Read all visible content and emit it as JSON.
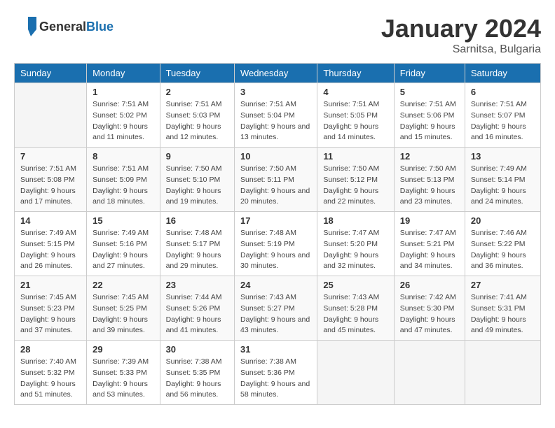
{
  "logo": {
    "general": "General",
    "blue": "Blue"
  },
  "title": "January 2024",
  "subtitle": "Sarnitsa, Bulgaria",
  "days_of_week": [
    "Sunday",
    "Monday",
    "Tuesday",
    "Wednesday",
    "Thursday",
    "Friday",
    "Saturday"
  ],
  "weeks": [
    [
      {
        "num": "",
        "sunrise": "",
        "sunset": "",
        "daylight": ""
      },
      {
        "num": "1",
        "sunrise": "Sunrise: 7:51 AM",
        "sunset": "Sunset: 5:02 PM",
        "daylight": "Daylight: 9 hours and 11 minutes."
      },
      {
        "num": "2",
        "sunrise": "Sunrise: 7:51 AM",
        "sunset": "Sunset: 5:03 PM",
        "daylight": "Daylight: 9 hours and 12 minutes."
      },
      {
        "num": "3",
        "sunrise": "Sunrise: 7:51 AM",
        "sunset": "Sunset: 5:04 PM",
        "daylight": "Daylight: 9 hours and 13 minutes."
      },
      {
        "num": "4",
        "sunrise": "Sunrise: 7:51 AM",
        "sunset": "Sunset: 5:05 PM",
        "daylight": "Daylight: 9 hours and 14 minutes."
      },
      {
        "num": "5",
        "sunrise": "Sunrise: 7:51 AM",
        "sunset": "Sunset: 5:06 PM",
        "daylight": "Daylight: 9 hours and 15 minutes."
      },
      {
        "num": "6",
        "sunrise": "Sunrise: 7:51 AM",
        "sunset": "Sunset: 5:07 PM",
        "daylight": "Daylight: 9 hours and 16 minutes."
      }
    ],
    [
      {
        "num": "7",
        "sunrise": "Sunrise: 7:51 AM",
        "sunset": "Sunset: 5:08 PM",
        "daylight": "Daylight: 9 hours and 17 minutes."
      },
      {
        "num": "8",
        "sunrise": "Sunrise: 7:51 AM",
        "sunset": "Sunset: 5:09 PM",
        "daylight": "Daylight: 9 hours and 18 minutes."
      },
      {
        "num": "9",
        "sunrise": "Sunrise: 7:50 AM",
        "sunset": "Sunset: 5:10 PM",
        "daylight": "Daylight: 9 hours and 19 minutes."
      },
      {
        "num": "10",
        "sunrise": "Sunrise: 7:50 AM",
        "sunset": "Sunset: 5:11 PM",
        "daylight": "Daylight: 9 hours and 20 minutes."
      },
      {
        "num": "11",
        "sunrise": "Sunrise: 7:50 AM",
        "sunset": "Sunset: 5:12 PM",
        "daylight": "Daylight: 9 hours and 22 minutes."
      },
      {
        "num": "12",
        "sunrise": "Sunrise: 7:50 AM",
        "sunset": "Sunset: 5:13 PM",
        "daylight": "Daylight: 9 hours and 23 minutes."
      },
      {
        "num": "13",
        "sunrise": "Sunrise: 7:49 AM",
        "sunset": "Sunset: 5:14 PM",
        "daylight": "Daylight: 9 hours and 24 minutes."
      }
    ],
    [
      {
        "num": "14",
        "sunrise": "Sunrise: 7:49 AM",
        "sunset": "Sunset: 5:15 PM",
        "daylight": "Daylight: 9 hours and 26 minutes."
      },
      {
        "num": "15",
        "sunrise": "Sunrise: 7:49 AM",
        "sunset": "Sunset: 5:16 PM",
        "daylight": "Daylight: 9 hours and 27 minutes."
      },
      {
        "num": "16",
        "sunrise": "Sunrise: 7:48 AM",
        "sunset": "Sunset: 5:17 PM",
        "daylight": "Daylight: 9 hours and 29 minutes."
      },
      {
        "num": "17",
        "sunrise": "Sunrise: 7:48 AM",
        "sunset": "Sunset: 5:19 PM",
        "daylight": "Daylight: 9 hours and 30 minutes."
      },
      {
        "num": "18",
        "sunrise": "Sunrise: 7:47 AM",
        "sunset": "Sunset: 5:20 PM",
        "daylight": "Daylight: 9 hours and 32 minutes."
      },
      {
        "num": "19",
        "sunrise": "Sunrise: 7:47 AM",
        "sunset": "Sunset: 5:21 PM",
        "daylight": "Daylight: 9 hours and 34 minutes."
      },
      {
        "num": "20",
        "sunrise": "Sunrise: 7:46 AM",
        "sunset": "Sunset: 5:22 PM",
        "daylight": "Daylight: 9 hours and 36 minutes."
      }
    ],
    [
      {
        "num": "21",
        "sunrise": "Sunrise: 7:45 AM",
        "sunset": "Sunset: 5:23 PM",
        "daylight": "Daylight: 9 hours and 37 minutes."
      },
      {
        "num": "22",
        "sunrise": "Sunrise: 7:45 AM",
        "sunset": "Sunset: 5:25 PM",
        "daylight": "Daylight: 9 hours and 39 minutes."
      },
      {
        "num": "23",
        "sunrise": "Sunrise: 7:44 AM",
        "sunset": "Sunset: 5:26 PM",
        "daylight": "Daylight: 9 hours and 41 minutes."
      },
      {
        "num": "24",
        "sunrise": "Sunrise: 7:43 AM",
        "sunset": "Sunset: 5:27 PM",
        "daylight": "Daylight: 9 hours and 43 minutes."
      },
      {
        "num": "25",
        "sunrise": "Sunrise: 7:43 AM",
        "sunset": "Sunset: 5:28 PM",
        "daylight": "Daylight: 9 hours and 45 minutes."
      },
      {
        "num": "26",
        "sunrise": "Sunrise: 7:42 AM",
        "sunset": "Sunset: 5:30 PM",
        "daylight": "Daylight: 9 hours and 47 minutes."
      },
      {
        "num": "27",
        "sunrise": "Sunrise: 7:41 AM",
        "sunset": "Sunset: 5:31 PM",
        "daylight": "Daylight: 9 hours and 49 minutes."
      }
    ],
    [
      {
        "num": "28",
        "sunrise": "Sunrise: 7:40 AM",
        "sunset": "Sunset: 5:32 PM",
        "daylight": "Daylight: 9 hours and 51 minutes."
      },
      {
        "num": "29",
        "sunrise": "Sunrise: 7:39 AM",
        "sunset": "Sunset: 5:33 PM",
        "daylight": "Daylight: 9 hours and 53 minutes."
      },
      {
        "num": "30",
        "sunrise": "Sunrise: 7:38 AM",
        "sunset": "Sunset: 5:35 PM",
        "daylight": "Daylight: 9 hours and 56 minutes."
      },
      {
        "num": "31",
        "sunrise": "Sunrise: 7:38 AM",
        "sunset": "Sunset: 5:36 PM",
        "daylight": "Daylight: 9 hours and 58 minutes."
      },
      {
        "num": "",
        "sunrise": "",
        "sunset": "",
        "daylight": ""
      },
      {
        "num": "",
        "sunrise": "",
        "sunset": "",
        "daylight": ""
      },
      {
        "num": "",
        "sunrise": "",
        "sunset": "",
        "daylight": ""
      }
    ]
  ]
}
